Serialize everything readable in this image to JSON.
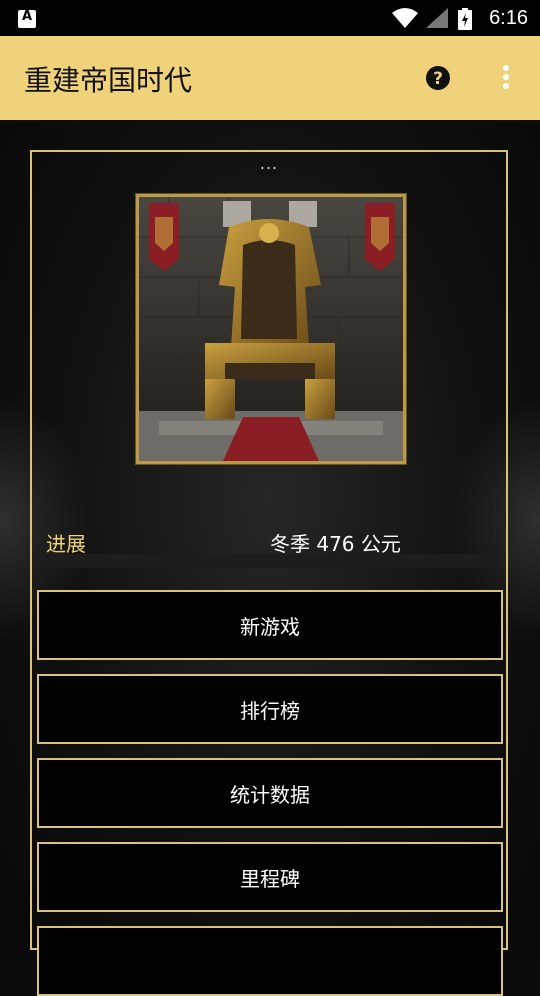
{
  "status_bar": {
    "time": "6:16",
    "app_icon_letter": "A"
  },
  "app_bar": {
    "title": "重建帝国时代",
    "help_icon": "help-circle-icon",
    "menu_icon": "more-vert-icon"
  },
  "panel": {
    "dots": "...",
    "progress_label": "进展",
    "progress_value": "冬季 476 公元",
    "buttons": [
      "新游戏",
      "排行榜",
      "统计数据",
      "里程碑"
    ]
  },
  "colors": {
    "accent": "#efd27a",
    "frame": "#d9c27a",
    "background": "#0c0c0c"
  }
}
